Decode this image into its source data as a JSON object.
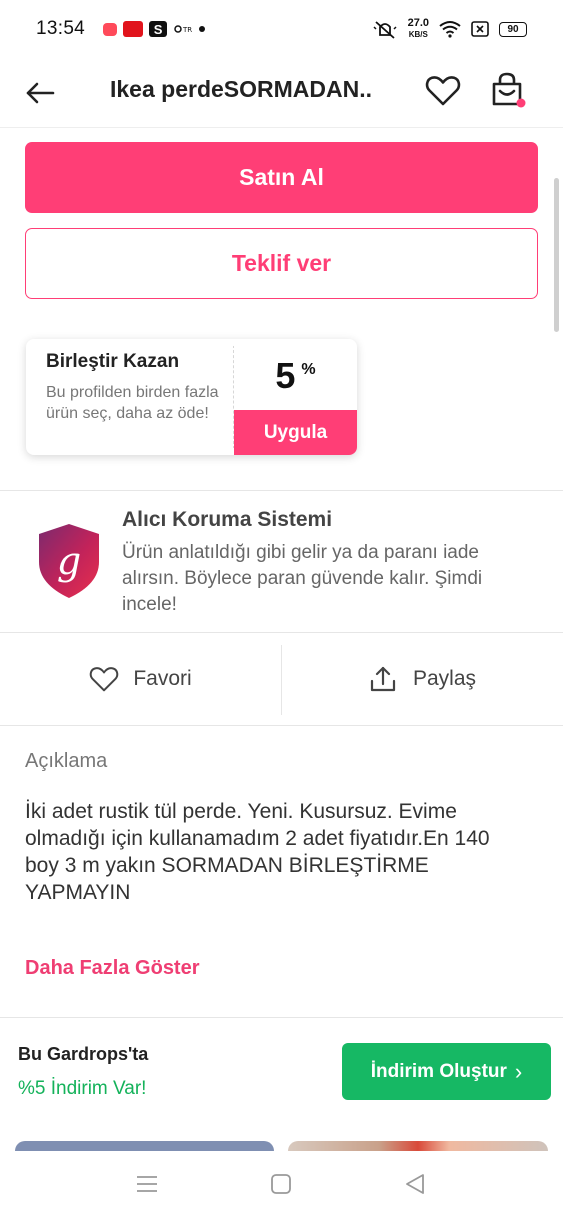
{
  "status_bar": {
    "time": "13:54",
    "net_speed_value": "27.0",
    "net_speed_unit": "KB/S",
    "battery": "90"
  },
  "header": {
    "title": "Ikea perdeSORMADAN..",
    "back_icon": "arrow-left-icon",
    "favorite_icon": "heart-icon",
    "cart_icon": "shopping-bag-icon"
  },
  "actions": {
    "buy_label": "Satın Al",
    "offer_label": "Teklif ver"
  },
  "combine_card": {
    "title": "Birleştir Kazan",
    "description": "Bu profilden birden fazla ürün seç, daha az öde!",
    "percent_value": "5",
    "percent_sign": "%",
    "apply_label": "Uygula"
  },
  "buyer_protection": {
    "title": "Alıcı Koruma Sistemi",
    "description": "Ürün anlatıldığı gibi gelir ya da paranı iade alırsın. Böylece paran güvende kalır. Şimdi incele!",
    "logo_letter": "g"
  },
  "social": {
    "favorite_label": "Favori",
    "share_label": "Paylaş"
  },
  "description": {
    "label": "Açıklama",
    "text": "İki adet rustik tül perde. Yeni. Kusursuz. Evime olmadığı için kullanamadım 2 adet fiyatıdır.En 140 boy 3 m yakın SORMADAN BİRLEŞTİRME YAPMAYIN",
    "show_more": "Daha Fazla Göster"
  },
  "promo": {
    "title": "Bu Gardrops'ta",
    "subtitle": "%5 İndirim Var!",
    "button_label": "İndirim Oluştur",
    "button_chevron": "›"
  },
  "colors": {
    "brand_pink": "#ff3e76",
    "promo_green": "#16b864",
    "promo_text_green": "#14b25a"
  }
}
